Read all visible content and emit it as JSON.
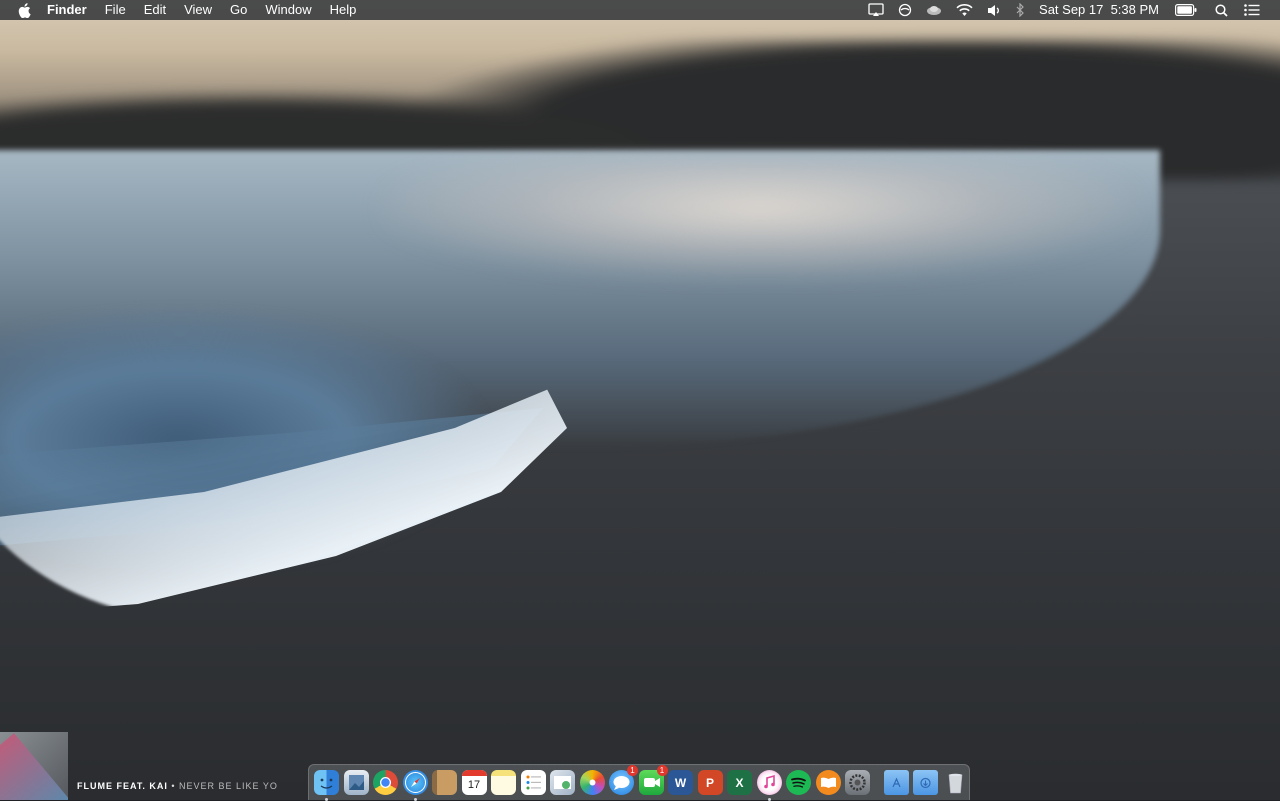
{
  "menubar": {
    "app_menus": [
      "Finder",
      "File",
      "Edit",
      "View",
      "Go",
      "Window",
      "Help"
    ],
    "status_icons": [
      "airplay-icon",
      "sync-icon",
      "cloud-icon",
      "wifi-icon",
      "volume-icon",
      "bluetooth-icon"
    ],
    "clock": "Sat Sep 17  5:38 PM",
    "right_icons": [
      "battery-icon",
      "spotlight-icon",
      "notification-center-icon"
    ]
  },
  "now_playing": {
    "artist": "FLUME FEAT. KAI",
    "separator": "•",
    "track": "NEVER BE LIKE YO"
  },
  "dock": {
    "apps": [
      {
        "name": "finder",
        "running": true
      },
      {
        "name": "preview",
        "running": false
      },
      {
        "name": "chrome",
        "running": false
      },
      {
        "name": "safari",
        "running": true
      },
      {
        "name": "contacts",
        "running": false
      },
      {
        "name": "calendar",
        "label": "17",
        "running": false
      },
      {
        "name": "notes",
        "running": false
      },
      {
        "name": "reminders",
        "running": false
      },
      {
        "name": "photo-preview",
        "running": false
      },
      {
        "name": "photos",
        "running": false
      },
      {
        "name": "messages",
        "badge": "1",
        "running": false
      },
      {
        "name": "facetime",
        "badge": "1",
        "running": false
      },
      {
        "name": "word",
        "label": "W",
        "running": false
      },
      {
        "name": "powerpoint",
        "label": "P",
        "running": false
      },
      {
        "name": "excel",
        "label": "X",
        "running": false
      },
      {
        "name": "itunes",
        "running": true
      },
      {
        "name": "spotify",
        "running": false
      },
      {
        "name": "ibooks",
        "running": false
      },
      {
        "name": "system-preferences",
        "running": false
      }
    ],
    "folders": [
      "applications-folder",
      "downloads-folder"
    ],
    "trash": "trash"
  },
  "colors": {
    "menubar": "#37393c",
    "chrome": "#dd4b39",
    "safari": "#1f8fe6",
    "spotify": "#1db954",
    "word": "#2b5797",
    "powerpoint": "#d24726",
    "excel": "#1e7145"
  }
}
